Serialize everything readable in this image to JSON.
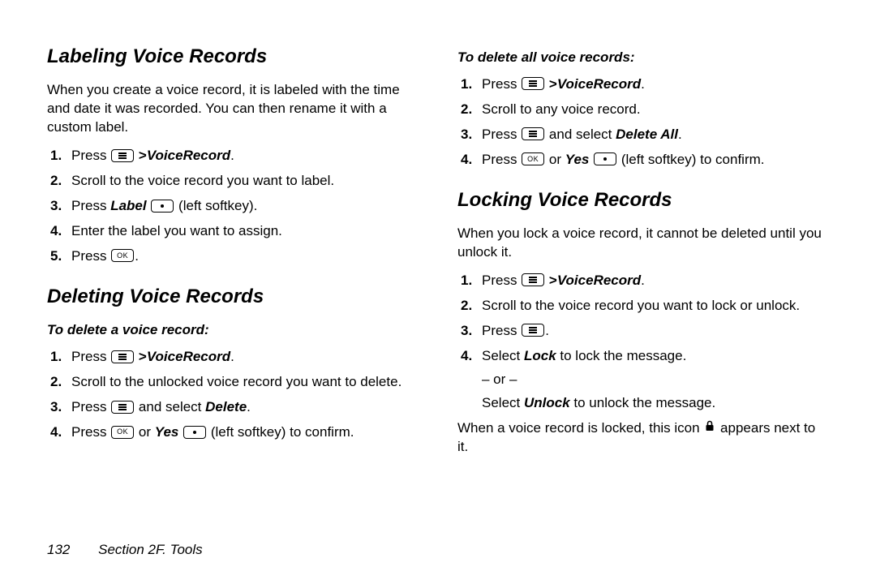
{
  "left": {
    "h1": "Labeling Voice Records",
    "p1": "When you create a voice record, it is labeled with the time and date it was recorded. You can then rename it with a custom label.",
    "s1_1a": "Press ",
    "s1_1b": " >",
    "s1_1c": "VoiceRecord",
    "s1_1d": ".",
    "s1_2": "Scroll to the voice record you want to label.",
    "s1_3a": "Press ",
    "s1_3b": "Label",
    "s1_3c": " (left softkey).",
    "s1_4": "Enter the label you want to assign.",
    "s1_5a": "Press ",
    "s1_5b": ".",
    "h2": "Deleting Voice Records",
    "sub1": "To delete a voice record:",
    "d1_1a": "Press ",
    "d1_1b": " >",
    "d1_1c": "VoiceRecord",
    "d1_1d": ".",
    "d1_2": "Scroll to the unlocked voice record you want to delete.",
    "d1_3a": "Press ",
    "d1_3b": "  and select ",
    "d1_3c": "Delete",
    "d1_3d": ".",
    "d1_4a": "Press ",
    "d1_4b": " or ",
    "d1_4c": "Yes",
    "d1_4d": " (left softkey) to confirm."
  },
  "right": {
    "sub2": "To delete all voice records:",
    "a1_1a": "Press ",
    "a1_1b": " >",
    "a1_1c": "VoiceRecord",
    "a1_1d": ".",
    "a1_2": "Scroll to any voice record.",
    "a1_3a": "Press ",
    "a1_3b": "  and select ",
    "a1_3c": "Delete All",
    "a1_3d": ".",
    "a1_4a": "Press ",
    "a1_4b": " or ",
    "a1_4c": "Yes",
    "a1_4d": " (left softkey) to confirm.",
    "h3": "Locking Voice Records",
    "p2": "When you lock a voice record, it cannot be deleted until you unlock it.",
    "l1_1a": "Press ",
    "l1_1b": " >",
    "l1_1c": "VoiceRecord",
    "l1_1d": ".",
    "l1_2": "Scroll to the voice record you want to lock or unlock.",
    "l1_3a": "Press ",
    "l1_3b": ".",
    "l1_4a": "Select ",
    "l1_4b": "Lock",
    "l1_4c": " to lock the message.",
    "l1_or": "– or –",
    "l1_5a": "Select ",
    "l1_5b": "Unlock",
    "l1_5c": " to unlock the message.",
    "p3a": "When a voice record is locked, this icon ",
    "p3b": " appears next to it."
  },
  "footer": {
    "page": "132",
    "section": "Section 2F. Tools"
  }
}
